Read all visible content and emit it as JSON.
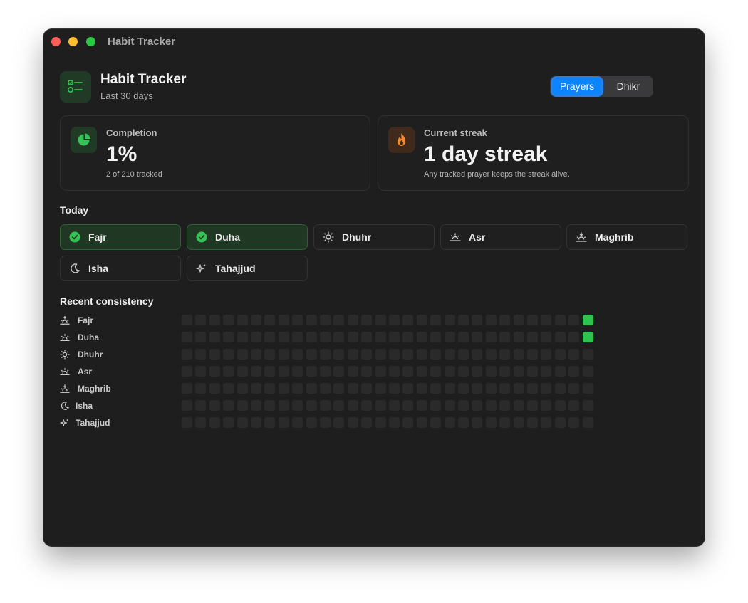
{
  "window": {
    "title": "Habit Tracker"
  },
  "header": {
    "title": "Habit Tracker",
    "subtitle": "Last 30 days"
  },
  "segment": {
    "prayers": "Prayers",
    "dhikr": "Dhikr",
    "selected": "Prayers"
  },
  "completion": {
    "label": "Completion",
    "value": "1%",
    "note": "2 of 210 tracked"
  },
  "streak": {
    "label": "Current streak",
    "value": "1 day streak",
    "note": "Any tracked prayer keeps the streak alive."
  },
  "today": {
    "title": "Today",
    "items": [
      {
        "label": "Fajr",
        "done": true,
        "icon": "check-circle-icon"
      },
      {
        "label": "Duha",
        "done": true,
        "icon": "check-circle-icon"
      },
      {
        "label": "Dhuhr",
        "done": false,
        "icon": "sun-icon"
      },
      {
        "label": "Asr",
        "done": false,
        "icon": "sun-low-icon"
      },
      {
        "label": "Maghrib",
        "done": false,
        "icon": "sunset-icon"
      },
      {
        "label": "Isha",
        "done": false,
        "icon": "moon-icon"
      },
      {
        "label": "Tahajjud",
        "done": false,
        "icon": "sparkles-icon"
      }
    ]
  },
  "consistency": {
    "title": "Recent consistency",
    "days": 30,
    "rows": [
      {
        "label": "Fajr",
        "icon": "sunrise-icon",
        "done_days": [
          30
        ]
      },
      {
        "label": "Duha",
        "icon": "sun-low-icon",
        "done_days": [
          30
        ]
      },
      {
        "label": "Dhuhr",
        "icon": "sun-icon",
        "done_days": []
      },
      {
        "label": "Asr",
        "icon": "sun-low-icon",
        "done_days": []
      },
      {
        "label": "Maghrib",
        "icon": "sunset-icon",
        "done_days": []
      },
      {
        "label": "Isha",
        "icon": "moon-icon",
        "done_days": []
      },
      {
        "label": "Tahajjud",
        "icon": "sparkles-icon",
        "done_days": []
      }
    ]
  },
  "colors": {
    "accent": "#0a84ff",
    "done": "#2ec24f",
    "flame": "#f08a2c"
  }
}
